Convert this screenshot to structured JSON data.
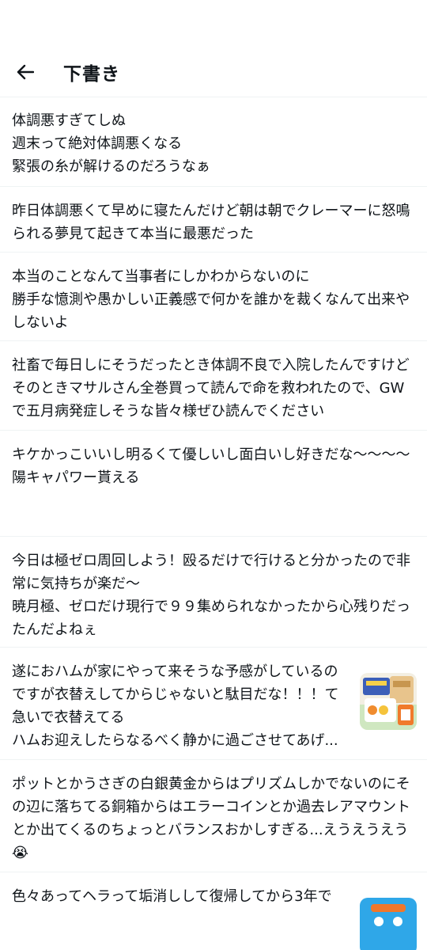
{
  "header": {
    "title": "下書き",
    "back_icon": "arrow-left-icon"
  },
  "drafts": [
    {
      "text": "体調悪すぎてしぬ\n週末って絶対体調悪くなる\n緊張の糸が解けるのだろうなぁ"
    },
    {
      "text": "昨日体調悪くて早めに寝たんだけど朝は朝でクレーマーに怒鳴られる夢見て起きて本当に最悪だった"
    },
    {
      "text": "本当のことなんて当事者にしかわからないのに\n勝手な憶測や愚かしい正義感で何かを誰かを裁くなんて出来やしないよ"
    },
    {
      "text": "社畜で毎日しにそうだったとき体調不良で入院したんですけどそのときマサルさん全巻買って読んで命を救われたので、GWで五月病発症しそうな皆々様ぜひ読んでください"
    },
    {
      "text": "キケかっこいいし明るくて優しいし面白いし好きだな〜〜〜〜陽キャパワー貰える"
    },
    {
      "text": "今日は極ゼロ周回しよう！殴るだけで行けると分かったので非常に気持ちが楽だ〜\n暁月極、ゼロだけ現行で９９集められなかったから心残りだったんだよねぇ"
    },
    {
      "text": "遂におハムが家にやって来そうな予感がしているのですが衣替えしてからじゃないと駄目だな！！！て急いで衣替えてる\nハムお迎えしたらなるべく静かに過ごさせてあげ...",
      "thumbnail": "product-photo"
    },
    {
      "text": "ポットとかうさぎの白銀黄金からはプリズムしかでないのにその辺に落ちてる銅箱からはエラーコインとか過去レアマウントとか出てくるのちょっとバランスおかしすぎる...えうえうえう😭"
    },
    {
      "text": "色々あってヘラって垢消しして復帰してから3年で",
      "thumbnail": "blue-image"
    }
  ]
}
